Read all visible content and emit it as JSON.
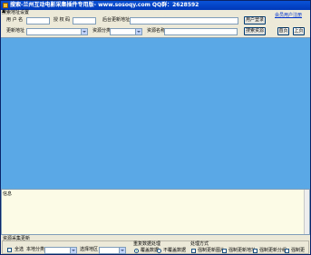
{
  "window": {
    "title": "搜索-兰州互动电影采集插件专用版- www.sosoqy.com QQ群：2628592",
    "menu_tab": "搜索地址设置"
  },
  "form": {
    "username_label": "用 户 名",
    "username_value": "",
    "password_label": "授 权 码",
    "password_value": "",
    "backend_url_label": "后台更新地址",
    "backend_url_value": "",
    "login_button": "用户登录",
    "join_link": "会员用户注册",
    "update_addr_label": "更新地址",
    "update_addr_value": "",
    "resource_cat_label": "资源分类",
    "resource_cat_value": "",
    "resource_name_label": "资源名称",
    "resource_name_value": "",
    "search_button": "搜索资源",
    "home_button": "首页",
    "prev_button": "上页"
  },
  "log": {
    "label": "信息"
  },
  "bottom": {
    "group_title": "资源采集更新",
    "select_all_label": "全选",
    "local_cat_label": "本地分类",
    "local_cat_value": "",
    "region_label": "选择地区",
    "region_value": "",
    "repeat_title": "重复数据处理",
    "radio_overwrite": "覆盖数据",
    "radio_skip": "不覆盖数据",
    "process_title": "处理方式",
    "cb_force_image": "强制更新图片",
    "cb_force_url": "强制更新地址",
    "cb_force_cat": "强制更新分组",
    "cb_force_info": "强制更"
  }
}
